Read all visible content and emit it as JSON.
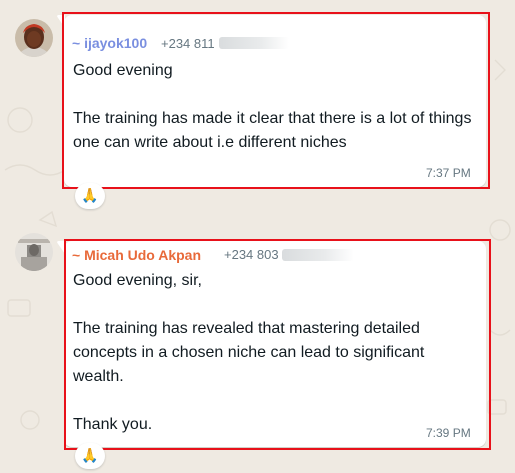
{
  "messages": [
    {
      "sender": "~ ijayok100",
      "phone": "+234 811",
      "text": "Good evening\n\nThe training has made it clear that there is a lot of things one can write about i.e different niches",
      "time": "7:37 PM",
      "reaction": "🙏"
    },
    {
      "sender": "~ Micah Udo Akpan",
      "phone": "+234 803",
      "text": "Good evening, sir,\n\nThe training has revealed that mastering detailed concepts in a chosen niche can lead to significant wealth.\n\nThank you.",
      "time": "7:39 PM",
      "reaction": "🙏"
    }
  ],
  "colors": {
    "chat_background": "#efeae2",
    "sender_1": "#7a8fe0",
    "sender_2": "#e86a3a",
    "highlight": "#e8111a",
    "timestamp": "#667781"
  },
  "icons": {
    "reaction": "folded-hands-emoji",
    "avatar_1": "profile-photo",
    "avatar_2": "profile-photo"
  }
}
